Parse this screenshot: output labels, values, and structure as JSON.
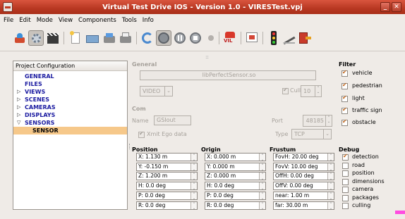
{
  "window": {
    "title": "Virtual Test Drive IOS - Version 1.0 - VIRESTest.vpj",
    "min_glyph": "_",
    "close_glyph": "✕"
  },
  "menu": [
    "File",
    "Edit",
    "Mode",
    "View",
    "Components",
    "Tools",
    "Info"
  ],
  "toolbar": {
    "vil_label": "VIL",
    "icons": [
      "scenario-icon",
      "settings-icon",
      "clapper-icon",
      "new-file-icon",
      "open-folder-icon",
      "save-icon",
      "save-as-icon",
      "refresh-icon",
      "play-icon",
      "pause-icon",
      "stop-icon",
      "record-icon",
      "vil-icon",
      "monitor-icon",
      "traffic-light-icon",
      "edit-icon",
      "exit-icon"
    ]
  },
  "project": {
    "header": "Project Configuration",
    "items": [
      {
        "label": "GENERAL",
        "arrow": ""
      },
      {
        "label": "FILES",
        "arrow": ""
      },
      {
        "label": "VIEWS",
        "arrow": "▷"
      },
      {
        "label": "SCENES",
        "arrow": "▷"
      },
      {
        "label": "CAMERAS",
        "arrow": "▷"
      },
      {
        "label": "DISPLAYS",
        "arrow": "▷"
      },
      {
        "label": "SENSORS",
        "arrow": "▽"
      }
    ],
    "selected_child": "SENSOR"
  },
  "general": {
    "title": "General",
    "plugin": "libPerfectSensor.so",
    "type_value": "VIDEO",
    "cull_label": "Cull",
    "cull_value": "10"
  },
  "com": {
    "title": "Com",
    "name_label": "Name",
    "name_value": "GSIout",
    "port_label": "Port",
    "port_value": "48185",
    "xmit_label": "Xmit Ego data",
    "type_label": "Type",
    "type_value": "TCP"
  },
  "filter": {
    "title": "Filter",
    "items": [
      {
        "label": "vehicle",
        "checked": true
      },
      {
        "label": "pedestrian",
        "checked": true
      },
      {
        "label": "light",
        "checked": true
      },
      {
        "label": "traffic sign",
        "checked": true
      },
      {
        "label": "obstacle",
        "checked": true
      }
    ]
  },
  "position": {
    "title": "Position",
    "values": [
      "X: 1.130 m",
      "Y: -0.150 m",
      "Z: 1.200 m",
      "H: 0.0 deg",
      "P: 0.0 deg",
      "R: 0.0 deg"
    ]
  },
  "origin": {
    "title": "Origin",
    "values": [
      "X: 0.000 m",
      "Y: 0.000 m",
      "Z: 0.000 m",
      "H: 0.0 deg",
      "P: 0.0 deg",
      "R: 0.0 deg"
    ]
  },
  "frustum": {
    "title": "Frustum",
    "values": [
      "FovH: 20.00 deg",
      "FovV: 10.00 deg",
      "OffH: 0.00 deg",
      "OffV: 0.00 deg",
      "near: 1.00 m",
      "far: 30.00 m"
    ]
  },
  "debug": {
    "title": "Debug",
    "items": [
      {
        "label": "detection",
        "checked": true
      },
      {
        "label": "road",
        "checked": false
      },
      {
        "label": "position",
        "checked": false
      },
      {
        "label": "dimensions",
        "checked": false
      },
      {
        "label": "camera",
        "checked": false
      },
      {
        "label": "packages",
        "checked": false
      },
      {
        "label": "culling",
        "checked": false
      }
    ]
  },
  "colors": {
    "title_bar": "#b83822",
    "tree_text": "#1a1aa0",
    "selection": "#f6c88a",
    "check": "#c2661b"
  }
}
